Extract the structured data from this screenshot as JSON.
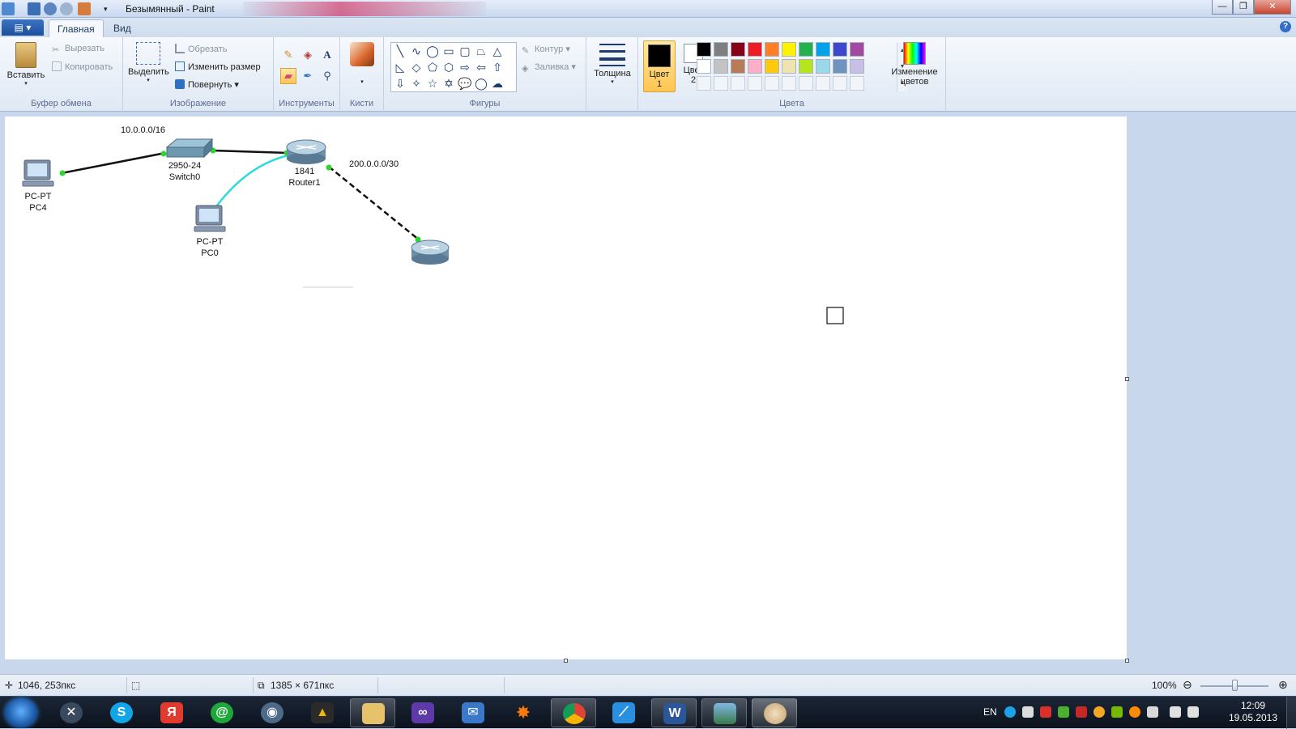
{
  "window": {
    "title": "Безымянный - Paint",
    "minimize": "—",
    "maximize": "❐",
    "close": "✕"
  },
  "tabs": {
    "app_menu": "▤ ▾",
    "items": [
      {
        "label": "Главная",
        "active": true
      },
      {
        "label": "Вид",
        "active": false
      }
    ],
    "help": "?"
  },
  "ribbon": {
    "clipboard": {
      "label": "Буфер обмена",
      "paste": "Вставить",
      "cut": "Вырезать",
      "copy": "Копировать"
    },
    "image": {
      "label": "Изображение",
      "select": "Выделить",
      "crop": "Обрезать",
      "resize": "Изменить размер",
      "rotate": "Повернуть"
    },
    "tools": {
      "label": "Инструменты"
    },
    "brushes": {
      "label": "Кисти"
    },
    "shapes": {
      "label": "Фигуры",
      "outline": "Контур",
      "fill": "Заливка",
      "icons": [
        "╲",
        "∿",
        "◯",
        "▭",
        "▢",
        "⏢",
        "△",
        "◺",
        "◇",
        "⬠",
        "⬡",
        "⇨",
        "⇦",
        "⇧",
        "⇩",
        "✧",
        "☆",
        "✡",
        "💬",
        "◯",
        "☁"
      ]
    },
    "size": {
      "label": "Толщина"
    },
    "colors": {
      "label": "Цвета",
      "color1_line1": "Цвет",
      "color1_line2": "1",
      "color2_line1": "Цвет",
      "color2_line2": "2",
      "edit_line1": "Изменение",
      "edit_line2": "цветов",
      "color1": "#000000",
      "color2": "#ffffff",
      "palette_row1": [
        "#000000",
        "#7f7f7f",
        "#880015",
        "#ed1c24",
        "#ff7f27",
        "#fff200",
        "#22b14c",
        "#00a2e8",
        "#3f48cc",
        "#a349a4"
      ],
      "palette_row2": [
        "#ffffff",
        "#c3c3c3",
        "#b97a57",
        "#ffaec9",
        "#ffc90e",
        "#efe4b0",
        "#b5e61d",
        "#99d9ea",
        "#7092be",
        "#c8bfe7"
      ]
    }
  },
  "diagram": {
    "network_label": "10.0.0.0/16",
    "wan_label": "200.0.0.0/30",
    "switch_model": "2950-24",
    "switch_name": "Switch0",
    "router_model": "1841",
    "router_name": "Router1",
    "pc4_model": "PC-PT",
    "pc4_name": "PC4",
    "pc0_model": "PC-PT",
    "pc0_name": "PC0"
  },
  "status": {
    "cursor_pos": "1046, 253пкс",
    "canvas_size": "1385 × 671пкс",
    "zoom": "100%"
  },
  "taskbar": {
    "lang": "EN",
    "time": "12:09",
    "date": "19.05.2013"
  }
}
